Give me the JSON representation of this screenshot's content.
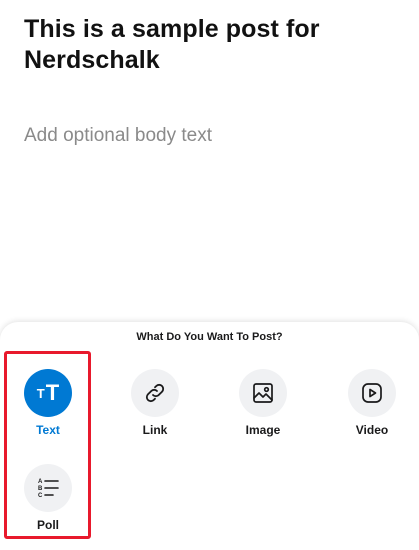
{
  "post": {
    "title": "This is a sample post for Nerdschalk",
    "body_value": "",
    "body_placeholder": "Add optional body text"
  },
  "sheet": {
    "title": "What Do You Want To Post?",
    "options": [
      {
        "label": "Text",
        "icon": "text-format-icon",
        "selected": true
      },
      {
        "label": "Link",
        "icon": "link-icon",
        "selected": false
      },
      {
        "label": "Image",
        "icon": "image-icon",
        "selected": false
      },
      {
        "label": "Video",
        "icon": "video-play-icon",
        "selected": false
      },
      {
        "label": "Poll",
        "icon": "poll-list-icon",
        "selected": false
      }
    ]
  },
  "colors": {
    "accent": "#0079d3",
    "highlight": "#e8192c",
    "icon_bg": "#f0f1f3",
    "placeholder": "#8a8a8a"
  }
}
